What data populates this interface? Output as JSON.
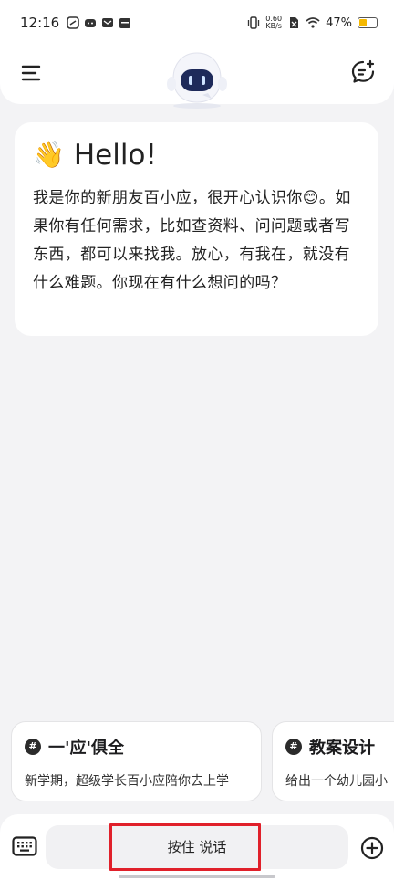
{
  "status_bar": {
    "time": "12:16",
    "net_speed_value": "0.60",
    "net_speed_unit": "KB/s",
    "battery_percent": "47%",
    "battery_level": 0.47,
    "battery_color": "#f5b800"
  },
  "header": {
    "menu_icon": "hamburger-menu-icon",
    "mascot_icon": "robot-mascot-icon",
    "new_chat_icon": "new-chat-icon"
  },
  "greeting": {
    "emoji": "👋",
    "title": "Hello!",
    "body": "我是你的新朋友百小应，很开心认识你😊。如果你有任何需求，比如查资料、问问题或者写东西，都可以来找我。放心，有我在，就没有什么难题。你现在有什么想问的吗？"
  },
  "suggestions": [
    {
      "title": "一'应'俱全",
      "desc": "新学期，超级学长百小应陪你去上学"
    },
    {
      "title": "教案设计",
      "desc": "给出一个幼儿园小"
    }
  ],
  "input_bar": {
    "voice_label": "按住 说话",
    "keyboard_icon": "keyboard-icon",
    "add_icon": "plus-circle-icon",
    "highlight_color": "#e0202a"
  }
}
